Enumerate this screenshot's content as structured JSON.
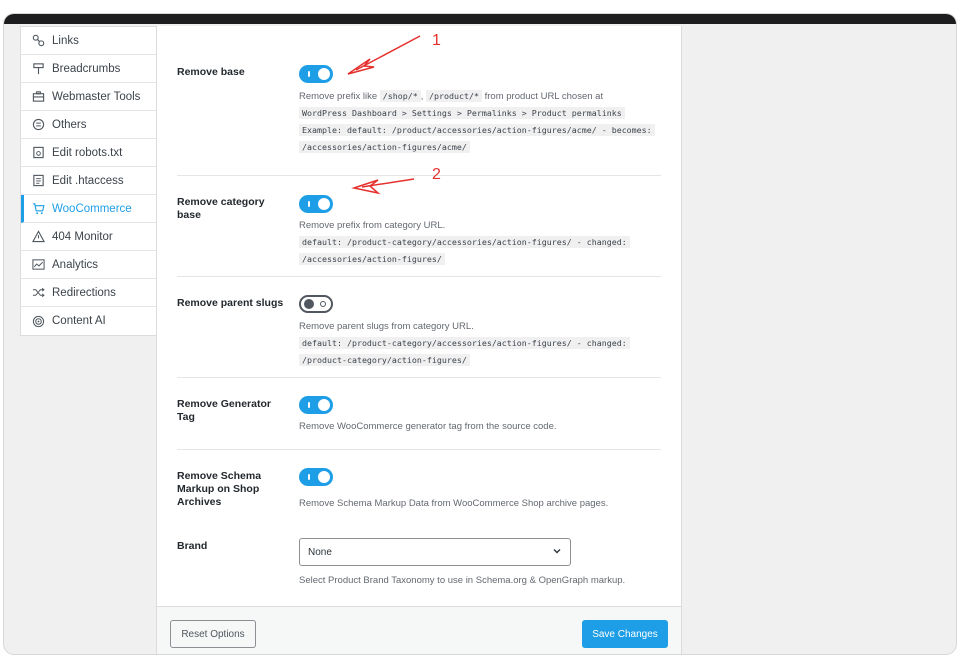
{
  "sidebar": {
    "items": [
      {
        "label": "Links",
        "icon": "link-icon"
      },
      {
        "label": "Breadcrumbs",
        "icon": "signpost-icon"
      },
      {
        "label": "Webmaster Tools",
        "icon": "toolbox-icon"
      },
      {
        "label": "Others",
        "icon": "circle-list-icon"
      },
      {
        "label": "Edit robots.txt",
        "icon": "robot-file-icon"
      },
      {
        "label": "Edit .htaccess",
        "icon": "file-text-icon"
      },
      {
        "label": "WooCommerce",
        "icon": "cart-icon",
        "active": true
      },
      {
        "label": "404 Monitor",
        "icon": "warning-icon"
      },
      {
        "label": "Analytics",
        "icon": "chart-line-icon"
      },
      {
        "label": "Redirections",
        "icon": "shuffle-icon"
      },
      {
        "label": "Content AI",
        "icon": "ai-icon"
      }
    ]
  },
  "settings": {
    "remove_base": {
      "label": "Remove base",
      "enabled": true,
      "desc_prefix": "Remove prefix like",
      "code1": "/shop/*",
      "sep": ",",
      "code2": "/product/*",
      "desc_suffix": "from product URL chosen at",
      "code3": "WordPress Dashboard > Settings > Permalinks > Product permalinks",
      "code4": "Example: default: /product/accessories/action-figures/acme/ - becomes:",
      "code5": "/accessories/action-figures/acme/"
    },
    "remove_category_base": {
      "label": "Remove category base",
      "enabled": true,
      "desc": "Remove prefix from category URL.",
      "code1": "default: /product-category/accessories/action-figures/ - changed:",
      "code2": "/accessories/action-figures/"
    },
    "remove_parent_slugs": {
      "label": "Remove parent slugs",
      "enabled": false,
      "desc": "Remove parent slugs from category URL.",
      "code1": "default: /product-category/accessories/action-figures/ - changed:",
      "code2": "/product-category/action-figures/"
    },
    "remove_generator_tag": {
      "label": "Remove Generator Tag",
      "enabled": true,
      "desc": "Remove WooCommerce generator tag from the source code."
    },
    "remove_schema_markup": {
      "label": "Remove Schema Markup on Shop Archives",
      "enabled": true,
      "desc": "Remove Schema Markup Data from WooCommerce Shop archive pages."
    },
    "brand": {
      "label": "Brand",
      "selected": "None",
      "desc": "Select Product Brand Taxonomy to use in Schema.org & OpenGraph markup."
    }
  },
  "footer": {
    "reset_label": "Reset Options",
    "save_label": "Save Changes"
  },
  "annotations": {
    "num1": "1",
    "num2": "2"
  },
  "colors": {
    "accent": "#1e9ee6",
    "annotation": "#e5312e"
  }
}
